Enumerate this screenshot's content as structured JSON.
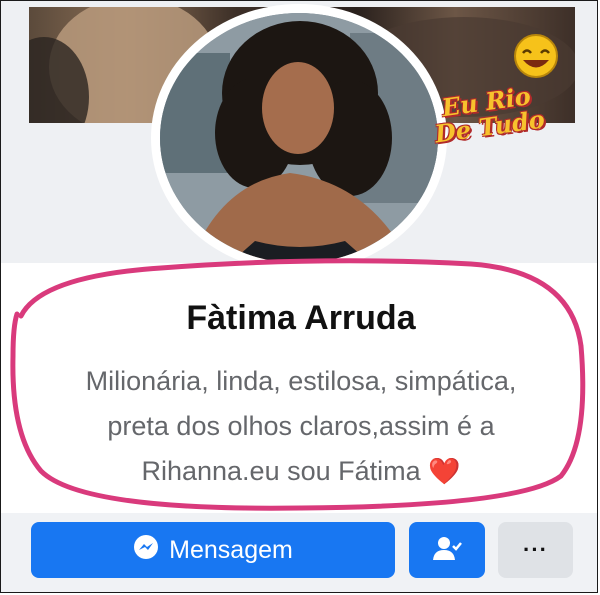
{
  "profile": {
    "name": "Fàtima Arruda",
    "bio_line1": "Milionária, linda, estilosa, simpática,",
    "bio_line2": "preta dos olhos claros,assim é a",
    "bio_line3": "Rihanna.eu sou Fátima",
    "bio_emoji": "❤️"
  },
  "watermark": {
    "line1": "Eu Rio",
    "line2": "De Tudo"
  },
  "actions": {
    "message_label": "Mensagem",
    "more_label": "···"
  },
  "colors": {
    "primary": "#1877f2",
    "secondary_button": "#dfe2e6",
    "annotation": "#d93a7c",
    "bio_text": "#65676b"
  },
  "icons": {
    "message": "messenger-icon",
    "friend": "friends-check-icon",
    "more": "more-dots-icon",
    "sticker": "laughing-emoji-icon"
  }
}
